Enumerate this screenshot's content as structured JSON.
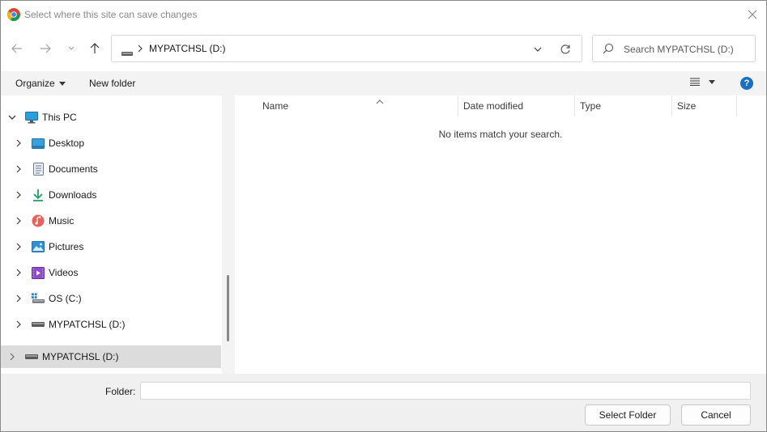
{
  "window": {
    "title": "Select where this site can save changes"
  },
  "nav": {
    "back_icon": "back-arrow-icon",
    "forward_icon": "forward-arrow-icon",
    "recent_icon": "chevron-down-icon",
    "up_icon": "up-arrow-icon"
  },
  "address": {
    "path": "MYPATCHSL (D:)"
  },
  "search": {
    "placeholder": "Search MYPATCHSL (D:)",
    "value": ""
  },
  "commandbar": {
    "organize_label": "Organize",
    "new_folder_label": "New folder",
    "help_label": "?"
  },
  "tree": {
    "items": [
      {
        "label": "This PC",
        "icon": "this-pc-icon",
        "expanded": true
      },
      {
        "label": "Desktop",
        "icon": "desktop-icon"
      },
      {
        "label": "Documents",
        "icon": "documents-icon"
      },
      {
        "label": "Downloads",
        "icon": "downloads-icon"
      },
      {
        "label": "Music",
        "icon": "music-icon"
      },
      {
        "label": "Pictures",
        "icon": "pictures-icon"
      },
      {
        "label": "Videos",
        "icon": "videos-icon"
      },
      {
        "label": "OS (C:)",
        "icon": "os-drive-icon"
      },
      {
        "label": "MYPATCHSL (D:)",
        "icon": "usb-drive-icon"
      },
      {
        "label": "MYPATCHSL (D:)",
        "icon": "usb-drive-icon",
        "selected": true
      }
    ]
  },
  "content": {
    "columns": [
      "Name",
      "Date modified",
      "Type",
      "Size"
    ],
    "empty_message": "No items match your search."
  },
  "bottom": {
    "folder_label": "Folder:",
    "folder_value": "",
    "select_label": "Select Folder",
    "cancel_label": "Cancel"
  }
}
